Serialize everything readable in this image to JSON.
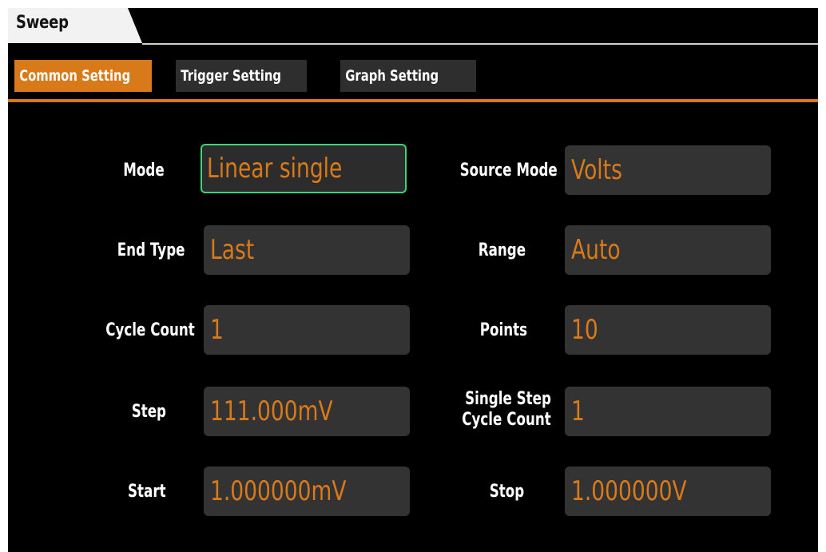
{
  "window": {
    "title": "Sweep"
  },
  "tabs": [
    {
      "label": "Common Setting",
      "active": true
    },
    {
      "label": "Trigger Setting",
      "active": false
    },
    {
      "label": "Graph Setting",
      "active": false
    }
  ],
  "fields": {
    "mode": {
      "label": "Mode",
      "value": "Linear single",
      "focused": true
    },
    "source_mode": {
      "label": "Source Mode",
      "value": "Volts"
    },
    "end_type": {
      "label": "End Type",
      "value": "Last"
    },
    "range": {
      "label": "Range",
      "value": "Auto"
    },
    "cycle_count": {
      "label": "Cycle Count",
      "value": "1"
    },
    "points": {
      "label": "Points",
      "value": "10"
    },
    "step": {
      "label": "Step",
      "value": "111.000mV"
    },
    "single_step_cycle_count": {
      "label_line1": "Single Step",
      "label_line2": "Cycle Count",
      "value": "1"
    },
    "start": {
      "label": "Start",
      "value": "1.000000mV"
    },
    "stop": {
      "label": "Stop",
      "value": "1.000000V"
    }
  },
  "colors": {
    "accent": "#d97a1a",
    "focus": "#3fd47a",
    "field_bg": "#333333",
    "background": "#000000"
  }
}
